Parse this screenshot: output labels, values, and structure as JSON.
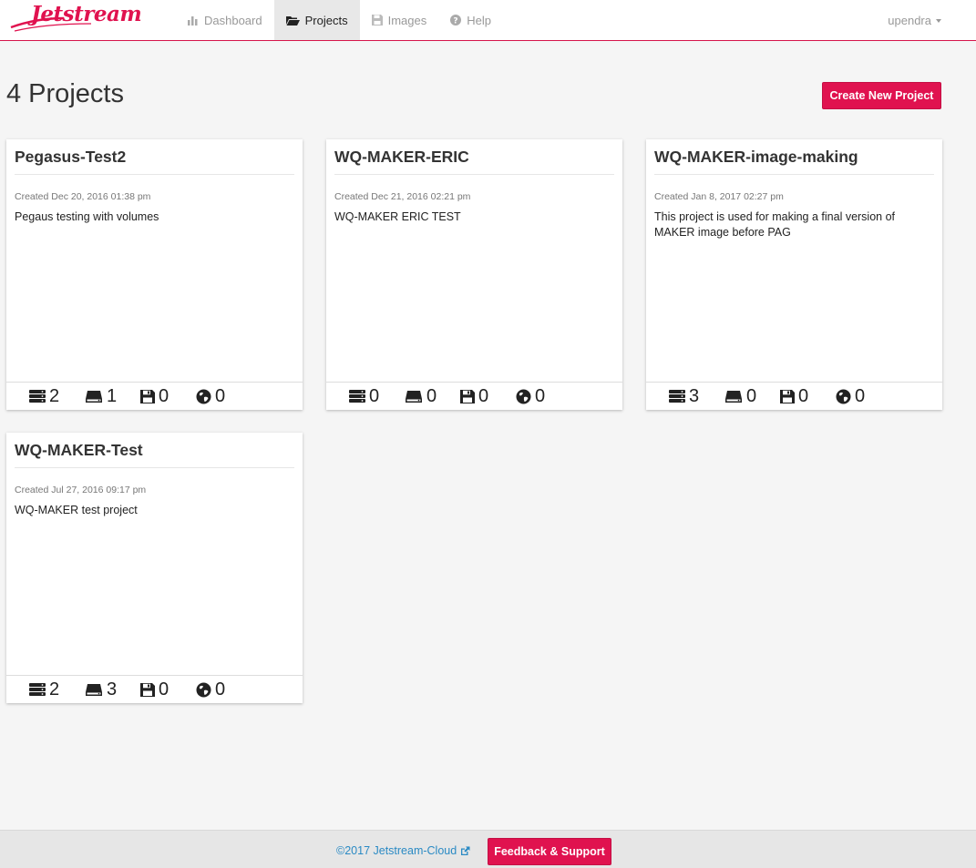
{
  "app": {
    "logo_text": "Jetstream",
    "brand_color": "#e0124f"
  },
  "nav": {
    "items": [
      {
        "label": "Dashboard",
        "icon": "bar-chart-icon",
        "active": false
      },
      {
        "label": "Projects",
        "icon": "folder-open-icon",
        "active": true
      },
      {
        "label": "Images",
        "icon": "floppy-disk-icon",
        "active": false
      },
      {
        "label": "Help",
        "icon": "question-circle-icon",
        "active": false
      }
    ],
    "user": "upendra"
  },
  "header": {
    "title": "4 Projects",
    "create_button": "Create New Project"
  },
  "projects": [
    {
      "name": "Pegasus-Test2",
      "created": "Created Dec 20, 2016 01:38 pm",
      "description": "Pegaus testing with volumes",
      "instances": "2",
      "volumes": "1",
      "images": "0",
      "links": "0"
    },
    {
      "name": "WQ-MAKER-ERIC",
      "created": "Created Dec 21, 2016 02:21 pm",
      "description": "WQ-MAKER ERIC TEST",
      "instances": "0",
      "volumes": "0",
      "images": "0",
      "links": "0"
    },
    {
      "name": "WQ-MAKER-image-making",
      "created": "Created Jan 8, 2017 02:27 pm",
      "description": "This project is used for making a final version of MAKER image before PAG",
      "instances": "3",
      "volumes": "0",
      "images": "0",
      "links": "0"
    },
    {
      "name": "WQ-MAKER-Test",
      "created": "Created Jul 27, 2016 09:17 pm",
      "description": "WQ-MAKER test project",
      "instances": "2",
      "volumes": "3",
      "images": "0",
      "links": "0"
    }
  ],
  "footer": {
    "copyright": "©2017 Jetstream-Cloud",
    "feedback_button": "Feedback & Support"
  }
}
